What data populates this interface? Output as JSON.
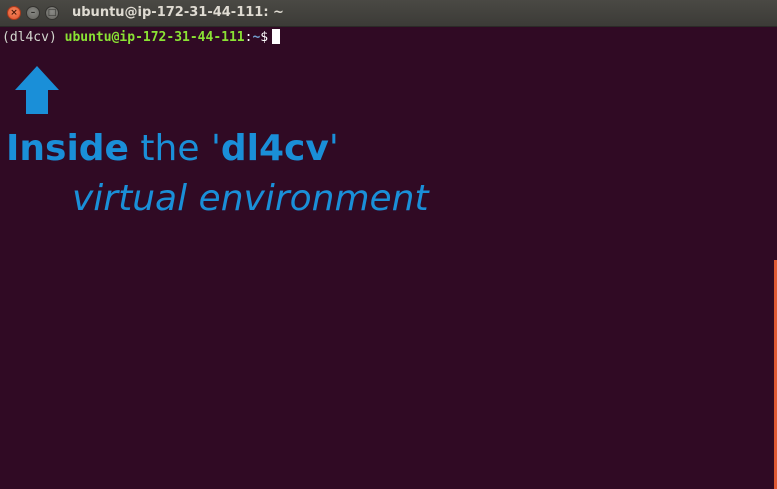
{
  "window": {
    "title": "ubuntu@ip-172-31-44-111: ~",
    "buttons": {
      "close": "×",
      "minimize": "–",
      "maximize": "□"
    }
  },
  "terminal": {
    "prompt": {
      "venv": "(dl4cv)",
      "userhost": "ubuntu@ip-172-31-44-111",
      "colon": ":",
      "path": "~",
      "dollar": "$"
    }
  },
  "annotation": {
    "word_inside": "Inside",
    "word_the": " the '",
    "env_name": "dl4cv",
    "quote_close": "'",
    "line2": "virtual environment",
    "arrow_icon": "up-arrow-icon",
    "color": "#1a8fd8"
  },
  "colors": {
    "background": "#300a24",
    "userhost": "#8ae234",
    "path": "#729fcf",
    "close_button": "#e2522b"
  }
}
